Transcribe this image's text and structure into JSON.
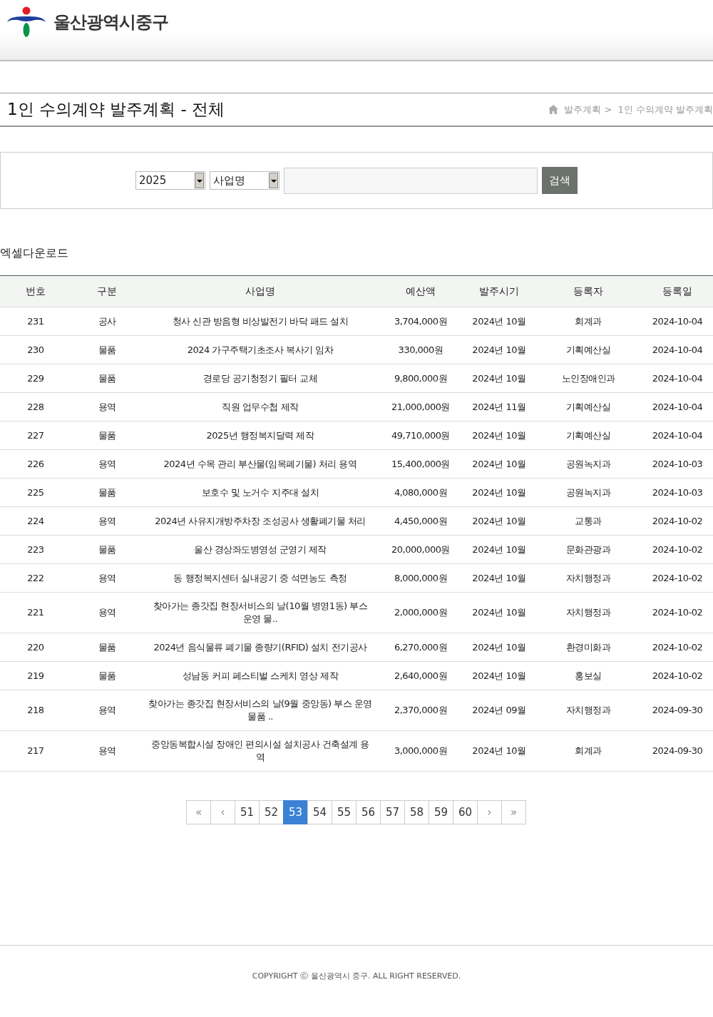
{
  "header": {
    "site_name": "울산광역시중구"
  },
  "page_title": "1인 수의계약 발주계획 - 전체",
  "breadcrumb": [
    "발주계획 >",
    "1인 수의계약 발주계획"
  ],
  "search": {
    "year": "2025",
    "field": "사업명",
    "button": "검색"
  },
  "excel_link": "엑셀다운로드",
  "table": {
    "columns": [
      "번호",
      "구분",
      "사업명",
      "예산액",
      "발주시기",
      "등록자",
      "등록일"
    ],
    "rows": [
      [
        "231",
        "공사",
        "청사 신관 방음형 비상발전기 바닥 패드 설치",
        "3,704,000원",
        "2024년 10월",
        "회계과",
        "2024-10-04"
      ],
      [
        "230",
        "물품",
        "2024 가구주택기초조사 복사기 임차",
        "330,000원",
        "2024년 10월",
        "기획예산실",
        "2024-10-04"
      ],
      [
        "229",
        "물품",
        "경로당 공기청정기 필터 교체",
        "9,800,000원",
        "2024년 10월",
        "노인장애인과",
        "2024-10-04"
      ],
      [
        "228",
        "용역",
        "직원 업무수첩 제작",
        "21,000,000원",
        "2024년 11월",
        "기획예산실",
        "2024-10-04"
      ],
      [
        "227",
        "물품",
        "2025년 행정복지달력 제작",
        "49,710,000원",
        "2024년 10월",
        "기획예산실",
        "2024-10-04"
      ],
      [
        "226",
        "용역",
        "2024년 수목 관리 부산물(임목폐기물) 처리 용역",
        "15,400,000원",
        "2024년 10월",
        "공원녹지과",
        "2024-10-03"
      ],
      [
        "225",
        "물품",
        "보호수 및 노거수 지주대 설치",
        "4,080,000원",
        "2024년 10월",
        "공원녹지과",
        "2024-10-03"
      ],
      [
        "224",
        "용역",
        "2024년 사유지개방주차장 조성공사 생활폐기물 처리",
        "4,450,000원",
        "2024년 10월",
        "교통과",
        "2024-10-02"
      ],
      [
        "223",
        "물품",
        "울산 경상좌도병영성 군영기 제작",
        "20,000,000원",
        "2024년 10월",
        "문화관광과",
        "2024-10-02"
      ],
      [
        "222",
        "용역",
        "동 행정복지센터 실내공기 중 석면농도 측정",
        "8,000,000원",
        "2024년 10월",
        "자치행정과",
        "2024-10-02"
      ],
      [
        "221",
        "용역",
        "찾아가는 종갓집 현장서비스의 날(10월 병영1동) 부스 운영 물..",
        "2,000,000원",
        "2024년 10월",
        "자치행정과",
        "2024-10-02"
      ],
      [
        "220",
        "물품",
        "2024년 음식물류 폐기물 종량기(RFID) 설치 전기공사",
        "6,270,000원",
        "2024년 10월",
        "환경미화과",
        "2024-10-02"
      ],
      [
        "219",
        "물품",
        "성남동 커피 페스티벌 스케치 영상 제작",
        "2,640,000원",
        "2024년 10월",
        "홍보실",
        "2024-10-02"
      ],
      [
        "218",
        "용역",
        "찾아가는 종갓집 현장서비스의 날(9월 중앙동) 부스 운영물품 ..",
        "2,370,000원",
        "2024년 09월",
        "자치행정과",
        "2024-09-30"
      ],
      [
        "217",
        "용역",
        "중앙동복합시설 장애인 편의시설 설치공사 건축설계 용역",
        "3,000,000원",
        "2024년 10월",
        "회계과",
        "2024-09-30"
      ]
    ]
  },
  "pagination": [
    {
      "label": "«",
      "kind": "nav",
      "selected": false
    },
    {
      "label": "‹",
      "kind": "nav",
      "selected": false
    },
    {
      "label": "51",
      "kind": "page",
      "selected": false
    },
    {
      "label": "52",
      "kind": "page",
      "selected": false
    },
    {
      "label": "53",
      "kind": "page",
      "selected": true
    },
    {
      "label": "54",
      "kind": "page",
      "selected": false
    },
    {
      "label": "55",
      "kind": "page",
      "selected": false
    },
    {
      "label": "56",
      "kind": "page",
      "selected": false
    },
    {
      "label": "57",
      "kind": "page",
      "selected": false
    },
    {
      "label": "58",
      "kind": "page",
      "selected": false
    },
    {
      "label": "59",
      "kind": "page",
      "selected": false
    },
    {
      "label": "60",
      "kind": "page",
      "selected": false
    },
    {
      "label": "›",
      "kind": "nav",
      "selected": false
    },
    {
      "label": "»",
      "kind": "nav",
      "selected": false
    }
  ],
  "footer": "COPYRIGHT ⓒ 울산광역시 중구. ALL RIGHT RESERVED."
}
